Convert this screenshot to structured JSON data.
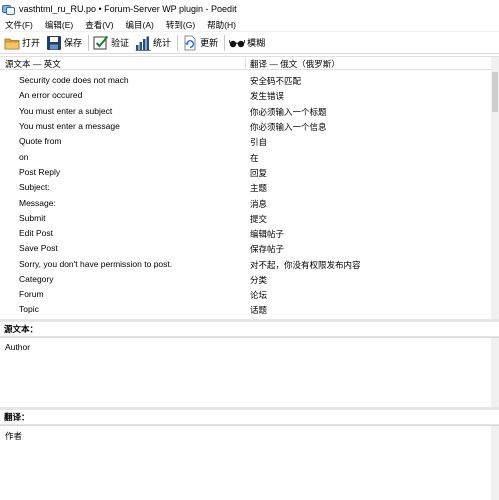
{
  "window": {
    "title": "vasthtml_ru_RU.po • Forum-Server WP plugin - Poedit"
  },
  "menu": [
    {
      "label": "文件(F)"
    },
    {
      "label": "编辑(E)"
    },
    {
      "label": "查看(V)"
    },
    {
      "label": "编目(A)"
    },
    {
      "label": "转到(G)"
    },
    {
      "label": "帮助(H)"
    }
  ],
  "toolbar": {
    "open_label": "打开",
    "save_label": "保存",
    "validate_label": "验证",
    "stats_label": "统计",
    "update_label": "更新",
    "fuzzy_label": "模糊"
  },
  "list": {
    "source_header": "源文本 — 英文",
    "translation_header": "翻译 — 俄文（俄罗斯）",
    "rows": [
      {
        "source": "Security code does not mach",
        "translation": "安全码不匹配"
      },
      {
        "source": "An error occured",
        "translation": "发生错误"
      },
      {
        "source": "You must enter a subject",
        "translation": "你必须输入一个标题"
      },
      {
        "source": "You must enter a message",
        "translation": "你必须输入一个信息"
      },
      {
        "source": "Quote from",
        "translation": "引自"
      },
      {
        "source": "on",
        "translation": "在"
      },
      {
        "source": "Post Reply",
        "translation": "回复"
      },
      {
        "source": "Subject:",
        "translation": "主题"
      },
      {
        "source": "Message:",
        "translation": "消息"
      },
      {
        "source": "Submit",
        "translation": "提交"
      },
      {
        "source": "Edit Post",
        "translation": "编辑帖子"
      },
      {
        "source": "Save Post",
        "translation": "保存帖子"
      },
      {
        "source": "Sorry, you don't have permission to post.",
        "translation": "对不起，你没有权限发布内容"
      },
      {
        "source": "Category",
        "translation": "分类"
      },
      {
        "source": "Forum",
        "translation": "论坛"
      },
      {
        "source": "Topic",
        "translation": "话题"
      }
    ]
  },
  "source_pane": {
    "label": "源文本：",
    "text": "Author"
  },
  "translation_pane": {
    "label": "翻译：",
    "text": "作者"
  },
  "colors": {
    "fuzzy_icon": "#000000",
    "stats_bars": "#1f4f8f",
    "validate_check": "#1f7a3a"
  }
}
